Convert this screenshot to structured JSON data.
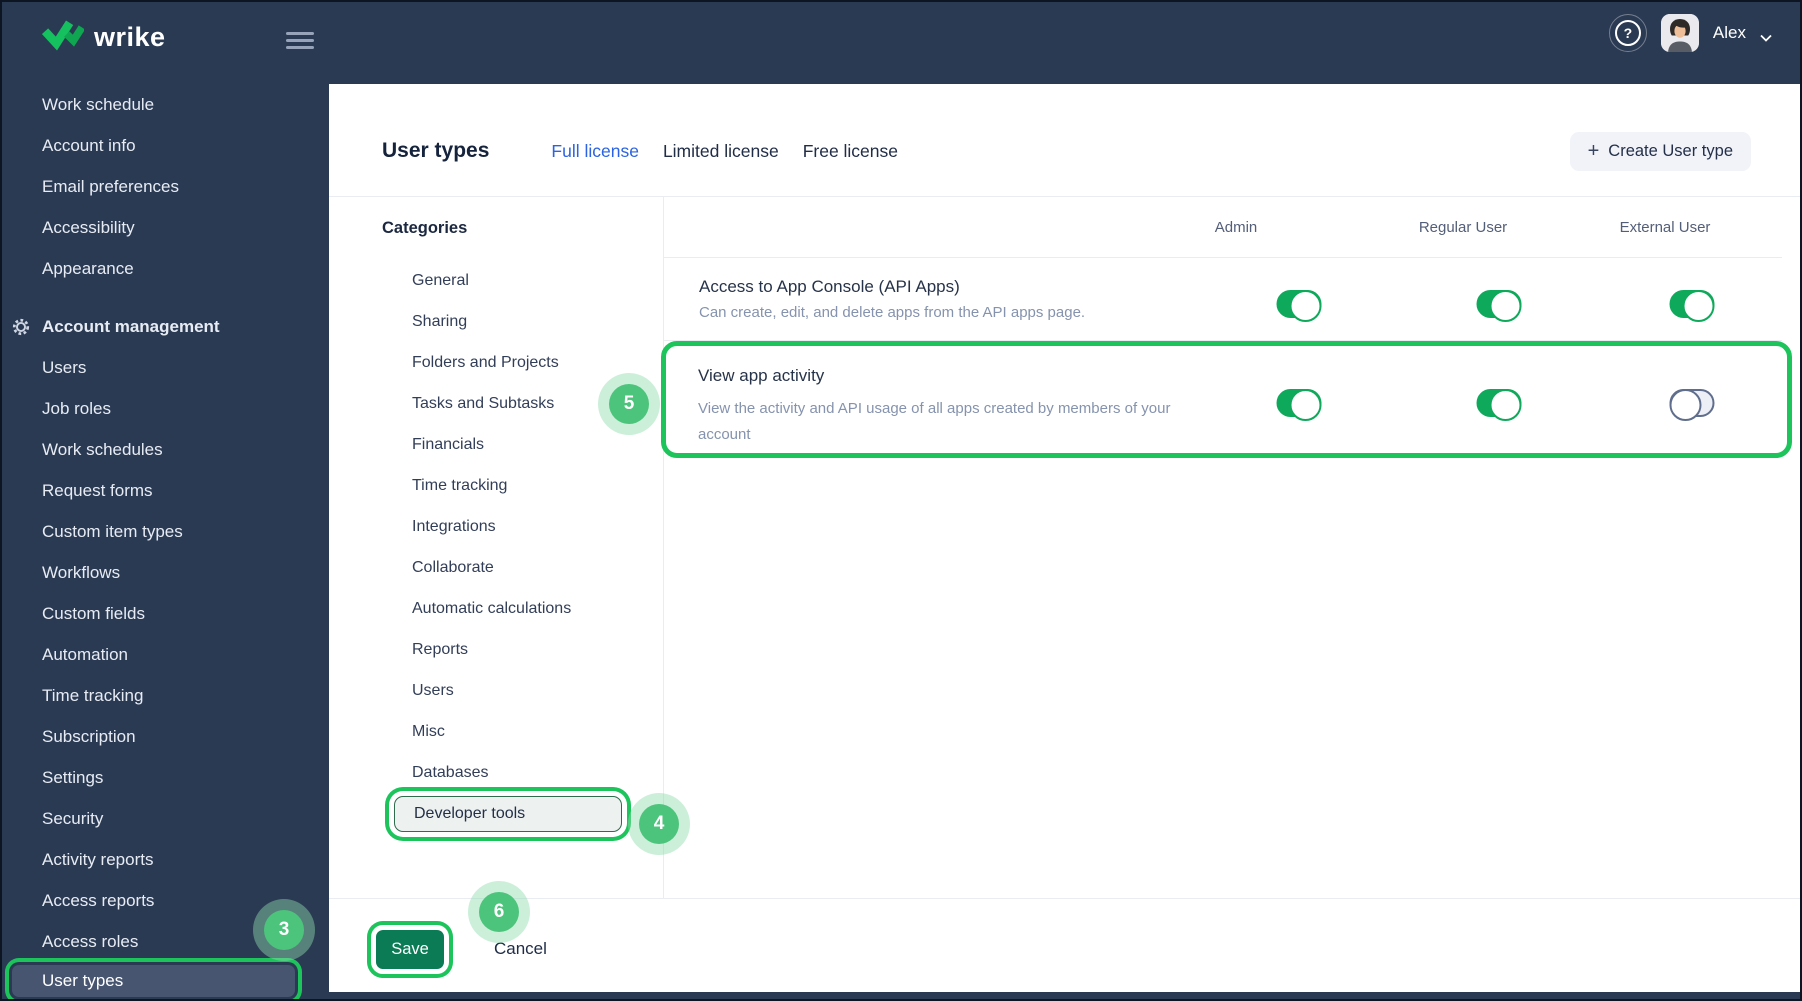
{
  "colors": {
    "navy": "#2B3A53",
    "accent_green": "#1DC45C",
    "badge_green": "#18B153",
    "toggle_on_green": "#0FA95B",
    "save_green": "#0A7B55",
    "active_tab_blue": "#2B63E2",
    "wrike_logo_green": "#15C05F",
    "selected_sidebar_bg": "#475570"
  },
  "topbar": {
    "logo_text": "wrike",
    "menu_icon": "hamburger-icon",
    "help_icon": "question-mark-icon",
    "user_name": "Alex",
    "user_chevron_icon": "chevron-down-icon"
  },
  "sidebar": {
    "top_items": [
      "Work schedule",
      "Account info",
      "Email preferences",
      "Accessibility",
      "Appearance"
    ],
    "section_label": "Account management",
    "section_icon": "gear-icon",
    "items": [
      "Users",
      "Job roles",
      "Work schedules",
      "Request forms",
      "Custom item types",
      "Workflows",
      "Custom fields",
      "Automation",
      "Time tracking",
      "Subscription",
      "Settings",
      "Security",
      "Activity reports",
      "Access reports",
      "Access roles"
    ],
    "selected_item": "User types"
  },
  "header": {
    "title": "User types",
    "tabs": [
      {
        "label": "Full license",
        "active": true
      },
      {
        "label": "Limited license",
        "active": false
      },
      {
        "label": "Free license",
        "active": false
      }
    ],
    "create_button_icon": "plus-icon",
    "create_button_label": "Create User type"
  },
  "categories": {
    "label": "Categories",
    "items": [
      "General",
      "Sharing",
      "Folders and Projects",
      "Tasks and Subtasks",
      "Financials",
      "Time tracking",
      "Integrations",
      "Collaborate",
      "Automatic calculations",
      "Reports",
      "Users",
      "Misc",
      "Databases",
      "Developer tools"
    ],
    "highlighted_item": "Developer tools"
  },
  "table": {
    "columns": [
      "Admin",
      "Regular User",
      "External User"
    ],
    "rows": [
      {
        "title": "Access to App Console (API Apps)",
        "description": "Can create, edit, and delete apps from the API apps page.",
        "toggles": [
          true,
          true,
          true
        ],
        "highlighted": false
      },
      {
        "title": "View app activity",
        "description": "View the activity and API usage of all apps created by members of your account",
        "toggles": [
          true,
          true,
          false
        ],
        "highlighted": true
      }
    ]
  },
  "footer": {
    "save_label": "Save",
    "cancel_label": "Cancel"
  },
  "annotations": {
    "badges": [
      {
        "number": "3",
        "target": "sidebar-user-types"
      },
      {
        "number": "4",
        "target": "category-developer-tools"
      },
      {
        "number": "5",
        "target": "view-app-activity-row"
      },
      {
        "number": "6",
        "target": "save-button"
      }
    ]
  }
}
